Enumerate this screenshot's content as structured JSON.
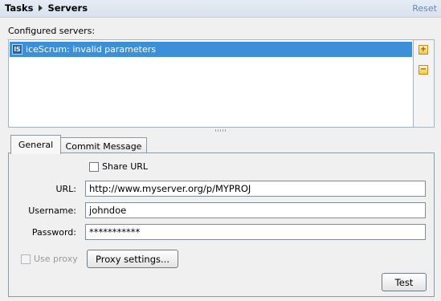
{
  "header": {
    "crumbs": [
      "Tasks",
      "Servers"
    ],
    "reset_label": "Reset"
  },
  "servers": {
    "section_label": "Configured servers:",
    "items": [
      {
        "icon_text": "IS",
        "label": "iceScrum: invalid parameters",
        "selected": true
      }
    ],
    "add_icon": "plus-icon",
    "remove_icon": "minus-icon"
  },
  "tabs": [
    {
      "label": "General",
      "active": true
    },
    {
      "label": "Commit Message",
      "active": false
    }
  ],
  "general": {
    "share_url_label": "Share URL",
    "share_url_checked": false,
    "url_label": "URL:",
    "url_value": "http://www.myserver.org/p/MYPROJ",
    "username_label": "Username:",
    "username_value": "johndoe",
    "password_label": "Password:",
    "password_value": "***********",
    "use_proxy_label": "Use proxy",
    "use_proxy_checked": false,
    "use_proxy_enabled": false,
    "proxy_settings_label": "Proxy settings...",
    "test_label": "Test"
  },
  "colors": {
    "selection": "#3d8fd8",
    "header_bg": "#dde5f0",
    "link": "#6a86b3",
    "icon_accent": "#f5c64a"
  }
}
